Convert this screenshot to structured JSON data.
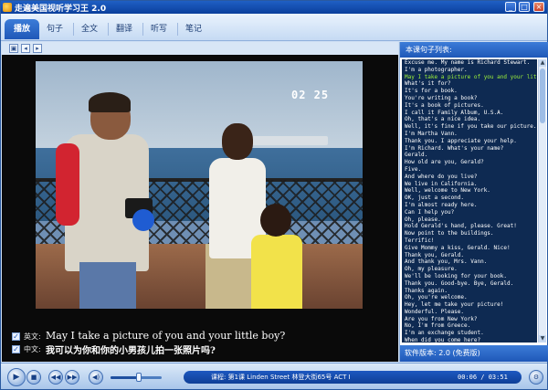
{
  "window": {
    "title": "走遍美国视听学习王 2.0"
  },
  "tabs": [
    {
      "label": "播放",
      "active": true
    },
    {
      "label": "句子"
    },
    {
      "label": "全文"
    },
    {
      "label": "翻译"
    },
    {
      "label": "听写"
    },
    {
      "label": "笔记"
    }
  ],
  "video": {
    "timestamp": "02 25"
  },
  "subtitles": {
    "english_label": "英文:",
    "english_text": "May I take a picture of you and your little boy?",
    "chinese_label": "中文:",
    "chinese_text": "我可以为你和你的小男孩儿拍一张照片吗?"
  },
  "sentence_panel": {
    "header": "本课句子列表:",
    "current_index": 2,
    "sentences": [
      "Excuse me. My name is Richard Stewart.",
      "I'm a photographer.",
      "May I take a picture of you and your little",
      "What's it for?",
      "It's for a book.",
      "You're writing a book?",
      "It's a book of pictures.",
      "I call it Family Album, U.S.A.",
      "Oh, that's a nice idea.",
      "Well, it's fine if you take our picture.",
      "I'm Martha Vann.",
      "Thank you. I appreciate your help.",
      "I'm Richard. What's your name?",
      "Gerald.",
      "How old are you, Gerald?",
      "Five.",
      "And where do you live?",
      "We live in California.",
      "Well, welcome to New York.",
      "OK, just a second.",
      "I'm almost ready here.",
      "Can I help you?",
      "Oh, please.",
      "Hold Gerald's hand, please. Great!",
      "Now point to the buildings.",
      "Terrific!",
      "Give Mommy a kiss, Gerald. Nice!",
      "Thank you, Gerald.",
      "And thank you, Mrs. Vann.",
      "Oh, my pleasure.",
      "We'll be looking for your book.",
      "Thank you. Good-bye. Bye, Gerald.",
      "Thanks again.",
      "Oh, you're welcome.",
      "Hey, let me take your picture!",
      "Wonderful. Please.",
      "Are you from New York?",
      "No, I'm from Greece.",
      "I'm an exchange student.",
      "When did you come here?",
      "Three months ago.",
      "Your English is very good.",
      "Thank you."
    ],
    "version_text": "软件版本: 2.0 (免费版)"
  },
  "controls": {
    "play_label": "▶",
    "stop_label": "■",
    "prev_label": "◀◀",
    "next_label": "▶▶",
    "repeat_label": "◀)",
    "volume_level": 0.55,
    "course_text": "课程: 第1课 Linden Street 林登大街65号 ACT I",
    "time_text": "00:06 / 03:51",
    "mode_label": "⚙"
  },
  "colors": {
    "accent": "#1f58b8",
    "current_sentence": "#9ef23a",
    "list_background": "#0e2a52"
  }
}
